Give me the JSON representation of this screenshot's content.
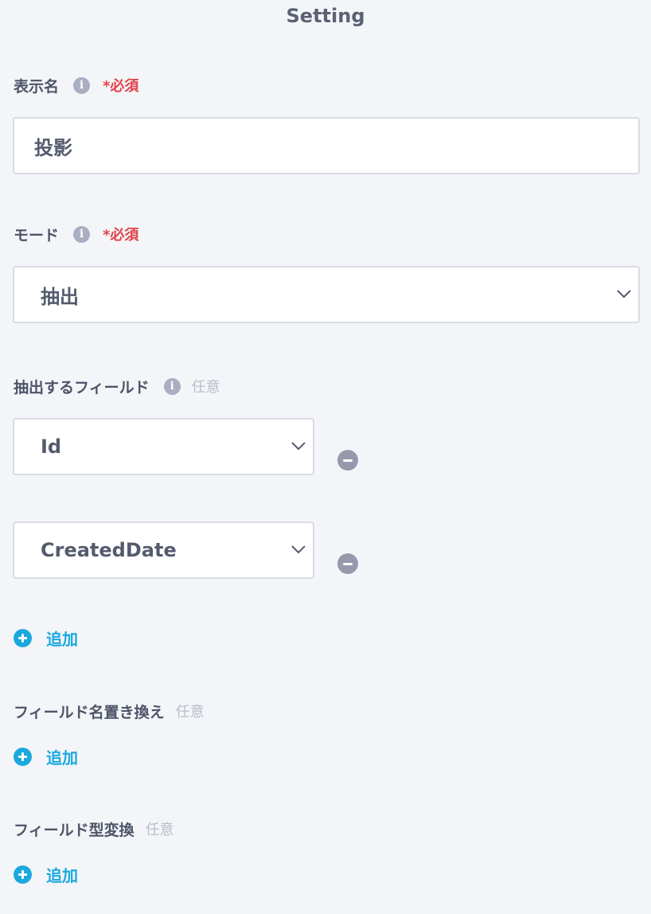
{
  "title": "Setting",
  "display_name": {
    "label": "表示名",
    "info_icon": "info-icon",
    "required": "*必須",
    "value": "投影"
  },
  "mode": {
    "label": "モード",
    "info_icon": "info-icon",
    "required": "*必須",
    "value": "抽出"
  },
  "extract_fields": {
    "label": "抽出するフィールド",
    "info_icon": "info-icon",
    "optional": "任意",
    "items": [
      {
        "value": "Id"
      },
      {
        "value": "CreatedDate"
      }
    ],
    "add_label": "追加"
  },
  "rename_fields": {
    "label": "フィールド名置き換え",
    "optional": "任意",
    "add_label": "追加"
  },
  "type_convert": {
    "label": "フィールド型変換",
    "optional": "任意",
    "add_label": "追加"
  },
  "colors": {
    "accent": "#1aa9de",
    "required": "#e0454c",
    "remove_button": "#9699ac"
  }
}
